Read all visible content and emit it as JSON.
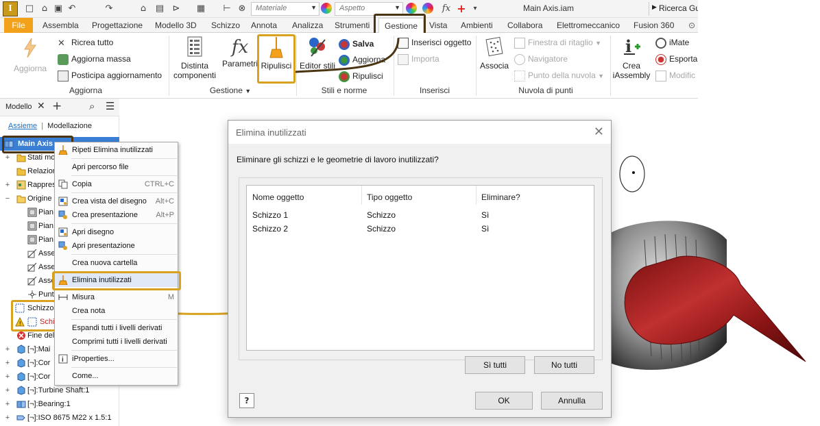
{
  "titlebar": {
    "logo": "I",
    "material_placeholder": "Materiale",
    "appearance_placeholder": "Aspetto",
    "fx": "fx",
    "document_title": "Main Axis.iam",
    "help_search": "Ricerca Gu"
  },
  "tabs": {
    "file": "File",
    "items": [
      "Assembla",
      "Progettazione",
      "Modello 3D",
      "Schizzo",
      "Annota",
      "Analizza",
      "Strumenti",
      "Gestione",
      "Vista",
      "Ambienti",
      "Collabora",
      "Elettromeccanico",
      "Fusion 360"
    ],
    "active": "Gestione"
  },
  "ribbon": {
    "aggiorna": {
      "big": "Aggiorna",
      "ricrea": "Ricrea tutto",
      "massa": "Aggiorna massa",
      "posticipa": "Posticipa aggiornamento",
      "group": "Aggiorna"
    },
    "gestione": {
      "distinta_1": "Distinta",
      "distinta_2": "componenti",
      "parametri": "Parametri",
      "ripulisci": "Ripulisci",
      "group": "Gestione"
    },
    "stili": {
      "editor": "Editor stili",
      "salva": "Salva",
      "aggiorna": "Aggiorna",
      "ripulisci": "Ripulisci",
      "group": "Stili e norme"
    },
    "inserisci": {
      "oggetto": "Inserisci oggetto",
      "importa": "Importa",
      "group": "Inserisci"
    },
    "nuvola": {
      "associa": "Associa",
      "finestra": "Finestra di ritaglio",
      "navigatore": "Navigatore",
      "punto": "Punto della nuvola",
      "group": "Nuvola di punti"
    },
    "extra": {
      "crea_1": "Crea",
      "crea_2": "iAssembly",
      "imate": "iMate",
      "esporta": "Esporta",
      "modifica": "Modific"
    }
  },
  "browser": {
    "tab": "Modello",
    "links": [
      "Assieme",
      "Modellazione"
    ],
    "rows": [
      {
        "label": "Main Axis",
        "bold": true
      },
      {
        "label": "Stati mo"
      },
      {
        "label": "Relazion"
      },
      {
        "label": "Rappres"
      },
      {
        "label": "Origine"
      },
      {
        "label": "Pian"
      },
      {
        "label": "Pian"
      },
      {
        "label": "Pian"
      },
      {
        "label": "Asse"
      },
      {
        "label": "Asse"
      },
      {
        "label": "Asse"
      },
      {
        "label": "Punt"
      },
      {
        "label": "Schizzo"
      },
      {
        "label": "Schi"
      },
      {
        "label": "Fine del"
      },
      {
        "label": "[¬]:Mai"
      },
      {
        "label": "[¬]:Cor"
      },
      {
        "label": "[¬]:Cor"
      },
      {
        "label": "[¬]:Turbine Shaft:1"
      },
      {
        "label": "[¬]:Bearing:1"
      },
      {
        "label": "[¬]:ISO 8675 M22 x 1.5:1"
      }
    ]
  },
  "context_menu": {
    "items": [
      {
        "label": "Ripeti Elimina inutilizzati",
        "shortcut": ""
      },
      {
        "label": "Apri percorso file",
        "shortcut": ""
      },
      {
        "label": "Copia",
        "shortcut": "CTRL+C"
      },
      {
        "label": "Crea vista del disegno",
        "shortcut": "Alt+C"
      },
      {
        "label": "Crea presentazione",
        "shortcut": "Alt+P"
      },
      {
        "label": "Apri disegno",
        "shortcut": ""
      },
      {
        "label": "Apri presentazione",
        "shortcut": ""
      },
      {
        "label": "Crea nuova cartella",
        "shortcut": ""
      },
      {
        "label": "Elimina inutilizzati",
        "shortcut": ""
      },
      {
        "label": "Misura",
        "shortcut": "M"
      },
      {
        "label": "Crea nota",
        "shortcut": ""
      },
      {
        "label": "Espandi tutti i livelli derivati",
        "shortcut": ""
      },
      {
        "label": "Comprimi tutti i livelli derivati",
        "shortcut": ""
      },
      {
        "label": "iProperties...",
        "shortcut": ""
      },
      {
        "label": "Come...",
        "shortcut": ""
      }
    ]
  },
  "dialog": {
    "title": "Elimina inutilizzati",
    "question": "Eliminare gli schizzi e le geometrie di lavoro inutilizzati?",
    "columns": [
      "Nome oggetto",
      "Tipo oggetto",
      "Eliminare?"
    ],
    "rows": [
      [
        "Schizzo 1",
        "Schizzo",
        "Sì"
      ],
      [
        "Schizzo 2",
        "Schizzo",
        "Sì"
      ]
    ],
    "yes_all": "Sì tutti",
    "no_all": "No tutti",
    "ok": "OK",
    "cancel": "Annulla"
  },
  "colors": {
    "accent": "#f2a21a",
    "callout_dark": "#4a3412",
    "callout_gold": "#d8a21e",
    "model_red": "#9a1c1c"
  }
}
